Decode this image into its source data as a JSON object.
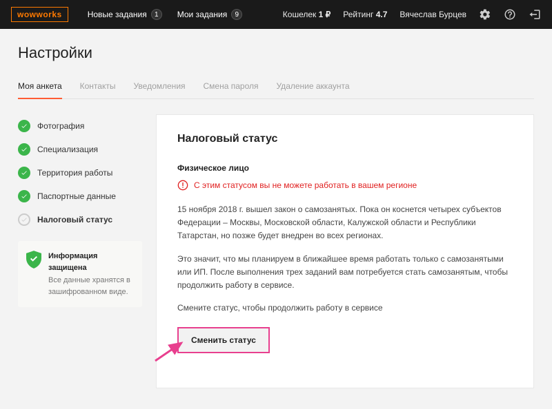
{
  "header": {
    "logo": "wowworks",
    "nav_new_tasks": "Новые задания",
    "nav_new_tasks_count": "1",
    "nav_my_tasks": "Мои задания",
    "nav_my_tasks_count": "9",
    "wallet_label": "Кошелек",
    "wallet_value": "1 ₽",
    "rating_label": "Рейтинг",
    "rating_value": "4.7",
    "user_name": "Вячеслав Бурцев"
  },
  "page_title": "Настройки",
  "tabs": [
    {
      "label": "Моя анкета",
      "active": true
    },
    {
      "label": "Контакты",
      "active": false
    },
    {
      "label": "Уведомления",
      "active": false
    },
    {
      "label": "Смена пароля",
      "active": false
    },
    {
      "label": "Удаление аккаунта",
      "active": false
    }
  ],
  "sidebar": {
    "steps": [
      {
        "label": "Фотография",
        "status": "done"
      },
      {
        "label": "Специализация",
        "status": "done"
      },
      {
        "label": "Территория работы",
        "status": "done"
      },
      {
        "label": "Паспортные данные",
        "status": "done"
      },
      {
        "label": "Налоговый статус",
        "status": "pending",
        "current": true
      }
    ],
    "info_title": "Информация защищена",
    "info_text": "Все данные хранятся в зашифрованном виде."
  },
  "panel": {
    "title": "Налоговый статус",
    "entity_label": "Физическое лицо",
    "warning": "С этим статусом вы не можете работать в вашем регионе",
    "p1": "15 ноября 2018 г. вышел закон о самозанятых. Пока он коснется четырех субъектов Федерации – Москвы, Московской области, Калужской области и Республики Татарстан, но позже будет внедрен во всех регионах.",
    "p2": "Это значит, что мы планируем в ближайшее время работать только с самозанятыми или ИП. После выполнения трех заданий вам потребуется стать самозанятым, чтобы продолжить работу в сервисе.",
    "p3": "Смените статус, чтобы продолжить работу в сервисе",
    "button": "Сменить статус"
  }
}
